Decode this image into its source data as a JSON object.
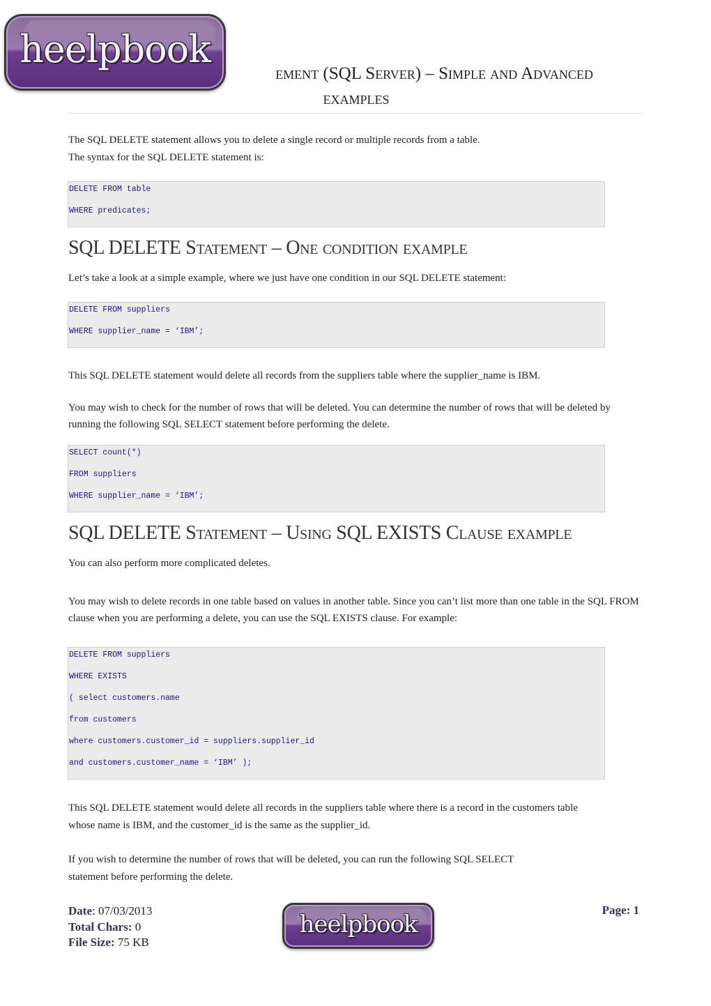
{
  "header": {
    "logo_text": "heelpbook",
    "title_line1": "ement (SQL Server) – Simple and Advanced",
    "title_line2": "examples"
  },
  "intro": {
    "p1": "The SQL DELETE statement allows you to delete a single record or multiple records from a table.",
    "p2": "The syntax for the SQL DELETE statement is:"
  },
  "code_syntax": [
    "DELETE FROM table",
    "WHERE predicates;"
  ],
  "section1": {
    "heading": "SQL DELETE Statement – One condition example",
    "p1": "Let’s take a look at a simple example, where we just have one condition in our SQL DELETE statement:",
    "code": [
      "DELETE FROM suppliers",
      "WHERE supplier_name = ‘IBM’;"
    ],
    "p2": "This SQL DELETE statement would delete all records from the suppliers table where the supplier_name is IBM.",
    "p3": "You may wish to check for the number of rows that will be deleted. You can determine the number of rows that will be deleted by running the following SQL SELECT statement before performing the delete.",
    "code2": [
      "SELECT count(*)",
      "FROM suppliers",
      "WHERE supplier_name = ‘IBM’;"
    ]
  },
  "section2": {
    "heading": "SQL DELETE Statement – Using SQL EXISTS Clause example",
    "p1": "You can also perform more complicated deletes.",
    "p2": "You may wish to delete records in one table based on values in another table. Since you can’t list more than one table in the SQL FROM clause when you are performing a delete, you can use the SQL EXISTS clause. For example:",
    "code": [
      "DELETE FROM suppliers",
      "WHERE EXISTS",
      "( select customers.name",
      "from customers",
      "where customers.customer_id = suppliers.supplier_id",
      "and customers.customer_name = ‘IBM’ );"
    ],
    "p3a": "This SQL DELETE statement would delete all records in the suppliers table where there is a record in the customers table",
    "p3b": "whose name is IBM, and the customer_id is the same as the supplier_id.",
    "p4a": "If you wish to determine the number of rows that will be deleted, you can run the following SQL SELECT",
    "p4b": "statement before performing the delete."
  },
  "footer": {
    "date_label": "Date",
    "date_value": "07/03/2013",
    "chars_label": "Total Chars:",
    "chars_value": "0",
    "size_label": "File Size:",
    "size_value": "75 KB",
    "page_label": "Page: 1",
    "logo_text": "heelpbook"
  }
}
